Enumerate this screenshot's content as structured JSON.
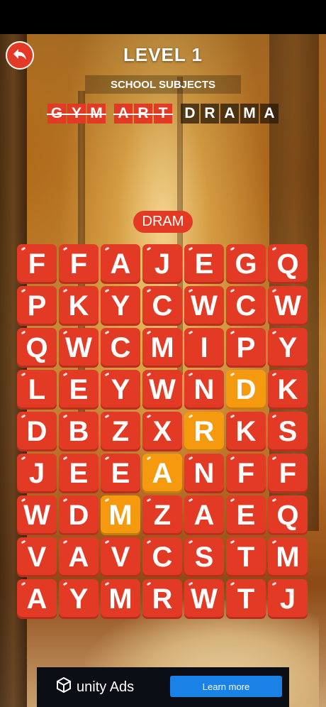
{
  "level": {
    "title": "LEVEL 1"
  },
  "category": "SCHOOL SUBJECTS",
  "target_words": [
    {
      "letters": [
        "G",
        "Y",
        "M"
      ],
      "found": true
    },
    {
      "letters": [
        "A",
        "R",
        "T"
      ],
      "found": true
    },
    {
      "letters": [
        "D",
        "R",
        "A",
        "M",
        "A"
      ],
      "found": false
    }
  ],
  "current_word": "DRAM",
  "grid": [
    [
      "F",
      "F",
      "A",
      "J",
      "E",
      "G",
      "Q"
    ],
    [
      "P",
      "K",
      "Y",
      "C",
      "W",
      "C",
      "W"
    ],
    [
      "Q",
      "W",
      "C",
      "M",
      "I",
      "P",
      "Y"
    ],
    [
      "L",
      "E",
      "Y",
      "W",
      "N",
      "D",
      "K"
    ],
    [
      "D",
      "B",
      "Z",
      "X",
      "R",
      "K",
      "S"
    ],
    [
      "J",
      "E",
      "E",
      "A",
      "N",
      "F",
      "F"
    ],
    [
      "W",
      "D",
      "M",
      "Z",
      "A",
      "E",
      "Q"
    ],
    [
      "V",
      "A",
      "V",
      "C",
      "S",
      "T",
      "M"
    ],
    [
      "A",
      "Y",
      "M",
      "R",
      "W",
      "T",
      "J"
    ]
  ],
  "selected_cells": [
    [
      3,
      5
    ],
    [
      4,
      4
    ],
    [
      5,
      3
    ],
    [
      6,
      2
    ]
  ],
  "ad": {
    "brand": "unity Ads",
    "button_label": "Learn more"
  },
  "icons": {
    "back": "back-arrow-icon",
    "unity": "unity-cube-icon"
  },
  "colors": {
    "tile": "#e23a25",
    "selected_tile": "#f59a0f",
    "ad_button": "#1a82e6"
  }
}
